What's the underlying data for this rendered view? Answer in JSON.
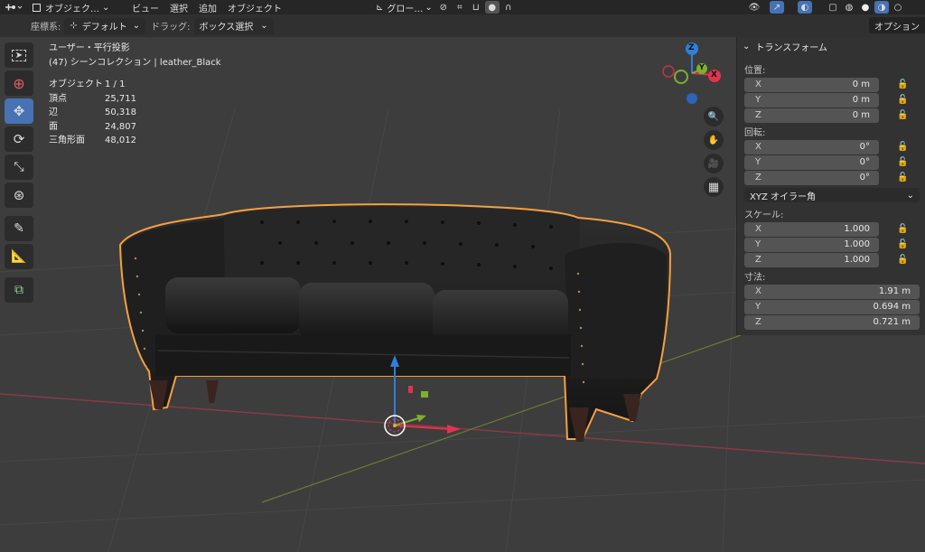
{
  "topbar": {
    "object_mode": "オブジェク…",
    "menus": [
      "ビュー",
      "選択",
      "追加",
      "オブジェクト"
    ],
    "orientation": "グロー…"
  },
  "header": {
    "coord_label": "座標系:",
    "coord_value": "デフォルト",
    "drag_label": "ドラッグ:",
    "drag_value": "ボックス選択",
    "options": "オプション"
  },
  "overlay": {
    "view": "ユーザー・平行投影",
    "collection": "(47) シーンコレクション | leather_Black",
    "stats": [
      {
        "k": "オブジェクト",
        "v": "1 / 1"
      },
      {
        "k": "頂点",
        "v": "25,711"
      },
      {
        "k": "辺",
        "v": "50,318"
      },
      {
        "k": "面",
        "v": "24,807"
      },
      {
        "k": "三角形面",
        "v": "48,012"
      }
    ]
  },
  "gizmo": {
    "x": "X",
    "y": "Y",
    "z": "Z"
  },
  "panel": {
    "title": "トランスフォーム",
    "location_label": "位置:",
    "location": [
      {
        "a": "X",
        "v": "0 m"
      },
      {
        "a": "Y",
        "v": "0 m"
      },
      {
        "a": "Z",
        "v": "0 m"
      }
    ],
    "rotation_label": "回転:",
    "rotation": [
      {
        "a": "X",
        "v": "0°"
      },
      {
        "a": "Y",
        "v": "0°"
      },
      {
        "a": "Z",
        "v": "0°"
      }
    ],
    "rotation_mode": "XYZ オイラー角",
    "scale_label": "スケール:",
    "scale": [
      {
        "a": "X",
        "v": "1.000"
      },
      {
        "a": "Y",
        "v": "1.000"
      },
      {
        "a": "Z",
        "v": "1.000"
      }
    ],
    "dims_label": "寸法:",
    "dims": [
      {
        "a": "X",
        "v": "1.91 m"
      },
      {
        "a": "Y",
        "v": "0.694 m"
      },
      {
        "a": "Z",
        "v": "0.721 m"
      }
    ]
  },
  "colors": {
    "accent": "#4772b3",
    "selection": "#f5a040",
    "x_axis": "#e0344c",
    "y_axis": "#7bb12c",
    "z_axis": "#2f7fd9"
  }
}
